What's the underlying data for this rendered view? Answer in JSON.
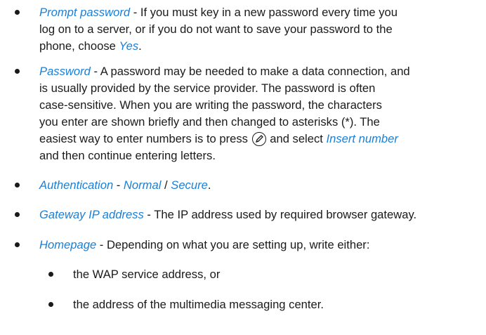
{
  "items": [
    {
      "term": "Prompt password",
      "sep": " - ",
      "lines": [
        "If you must key in a new password every time you",
        "log on to a server, or if you do not want to save your password to the",
        "phone, choose "
      ],
      "tail_term": "Yes",
      "tail_text": "."
    },
    {
      "term": "Password",
      "sep": " - ",
      "lines": [
        "A password may be needed to make a data connection, and",
        "is usually provided by the service provider. The password is often",
        "case-sensitive. When you are writing the password, the characters",
        "you enter are shown briefly and then changed to asterisks (*). The",
        "easiest way to enter numbers is to press",
        "and select",
        "and then continue entering letters."
      ],
      "inline_term": "Insert number",
      "key_icon": "pen-key-icon"
    },
    {
      "term": "Authentication",
      "sep": " - ",
      "opt1": "Normal",
      "slash": " / ",
      "opt2": "Secure",
      "end": "."
    },
    {
      "term": "Gateway IP address",
      "sep": " - ",
      "text": "The IP address used by required browser gateway."
    },
    {
      "term": "Homepage",
      "sep": " - ",
      "text": "Depending on what you are setting up, write either:",
      "subitems": [
        "the WAP service address, or",
        "the address of the multimedia messaging center."
      ]
    }
  ],
  "colors": {
    "term": "#1a7fd6",
    "text": "#1a1a1a"
  }
}
